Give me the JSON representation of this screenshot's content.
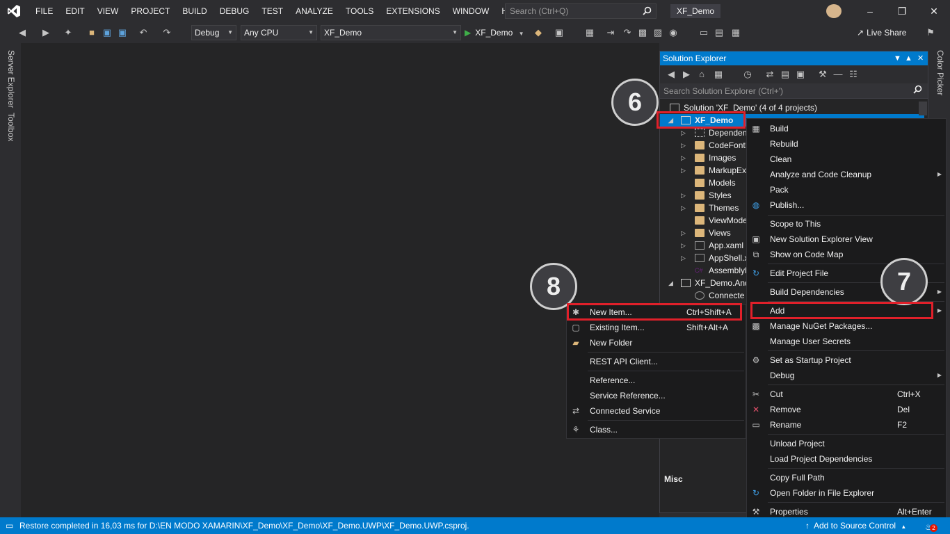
{
  "menu": [
    "FILE",
    "EDIT",
    "VIEW",
    "PROJECT",
    "BUILD",
    "DEBUG",
    "TEST",
    "ANALYZE",
    "TOOLS",
    "EXTENSIONS",
    "WINDOW",
    "HELP"
  ],
  "search_placeholder": "Search (Ctrl+Q)",
  "window_title": "XF_Demo",
  "toolbar": {
    "config": "Debug",
    "platform": "Any CPU",
    "startup_project": "XF_Demo",
    "run_target": "XF_Demo",
    "live_share": "Live Share"
  },
  "side_tabs": {
    "server_explorer": "Server Explorer",
    "toolbox": "Toolbox",
    "color_picker": "Color Picker"
  },
  "solution_explorer": {
    "title": "Solution Explorer",
    "search_placeholder": "Search Solution Explorer (Ctrl+')",
    "solution_label": "Solution 'XF_Demo' (4 of 4 projects)",
    "items": [
      {
        "label": "XF_Demo",
        "kind": "project",
        "selected": true
      },
      {
        "label": "Dependen",
        "kind": "dependencies"
      },
      {
        "label": "CodeFontI",
        "kind": "folder"
      },
      {
        "label": "Images",
        "kind": "folder"
      },
      {
        "label": "MarkupEx",
        "kind": "folder"
      },
      {
        "label": "Models",
        "kind": "folder"
      },
      {
        "label": "Styles",
        "kind": "folder"
      },
      {
        "label": "Themes",
        "kind": "folder"
      },
      {
        "label": "ViewMode",
        "kind": "folder"
      },
      {
        "label": "Views",
        "kind": "folder"
      },
      {
        "label": "App.xaml",
        "kind": "xaml"
      },
      {
        "label": "AppShell.x",
        "kind": "xaml"
      },
      {
        "label": "Assemblyl",
        "kind": "csharp"
      },
      {
        "label": "XF_Demo.And",
        "kind": "project"
      },
      {
        "label": "Connecte",
        "kind": "service"
      }
    ],
    "misc_label": "Misc"
  },
  "project_menu": {
    "items": [
      {
        "label": "Build",
        "icon": "build-icon"
      },
      {
        "label": "Rebuild"
      },
      {
        "label": "Clean"
      },
      {
        "label": "Analyze and Code Cleanup",
        "submenu": true
      },
      {
        "label": "Pack"
      },
      {
        "label": "Publish...",
        "icon": "globe-icon"
      },
      {
        "label": "Scope to This"
      },
      {
        "label": "New Solution Explorer View",
        "icon": "new-view-icon"
      },
      {
        "label": "Show on Code Map",
        "icon": "code-map-icon"
      },
      {
        "label": "Edit Project File",
        "icon": "refresh-icon"
      },
      {
        "label": "Build Dependencies",
        "submenu": true
      },
      {
        "label": "Add",
        "submenu": true,
        "highlighted": true
      },
      {
        "label": "Manage NuGet Packages...",
        "icon": "nuget-icon"
      },
      {
        "label": "Manage User Secrets"
      },
      {
        "label": "Set as Startup Project",
        "icon": "gear-icon"
      },
      {
        "label": "Debug",
        "submenu": true
      },
      {
        "label": "Cut",
        "shortcut": "Ctrl+X",
        "icon": "scissors-icon"
      },
      {
        "label": "Remove",
        "shortcut": "Del",
        "icon": "close-icon"
      },
      {
        "label": "Rename",
        "shortcut": "F2",
        "icon": "rename-icon"
      },
      {
        "label": "Unload Project"
      },
      {
        "label": "Load Project Dependencies"
      },
      {
        "label": "Copy Full Path"
      },
      {
        "label": "Open Folder in File Explorer",
        "icon": "refresh-icon"
      },
      {
        "label": "Properties",
        "shortcut": "Alt+Enter",
        "icon": "wrench-icon"
      }
    ]
  },
  "add_menu": {
    "items": [
      {
        "label": "New Item...",
        "shortcut": "Ctrl+Shift+A",
        "icon": "new-item-icon"
      },
      {
        "label": "Existing Item...",
        "shortcut": "Shift+Alt+A",
        "icon": "existing-item-icon"
      },
      {
        "label": "New Folder",
        "icon": "new-folder-icon"
      },
      {
        "label": "REST API Client..."
      },
      {
        "label": "Reference..."
      },
      {
        "label": "Service Reference..."
      },
      {
        "label": "Connected Service",
        "icon": "connected-service-icon"
      },
      {
        "label": "Class...",
        "icon": "class-icon"
      }
    ]
  },
  "annotations": {
    "step6": "6",
    "step7": "7",
    "step8": "8"
  },
  "status": {
    "message": "Restore completed in 16,03 ms for D:\\EN MODO XAMARIN\\XF_Demo\\XF_Demo\\XF_Demo.UWP\\XF_Demo.UWP.csproj.",
    "source_control": "Add to Source Control",
    "notification_count": "2"
  },
  "colors": {
    "accent": "#007acc",
    "annotation_red": "#e0202a"
  }
}
